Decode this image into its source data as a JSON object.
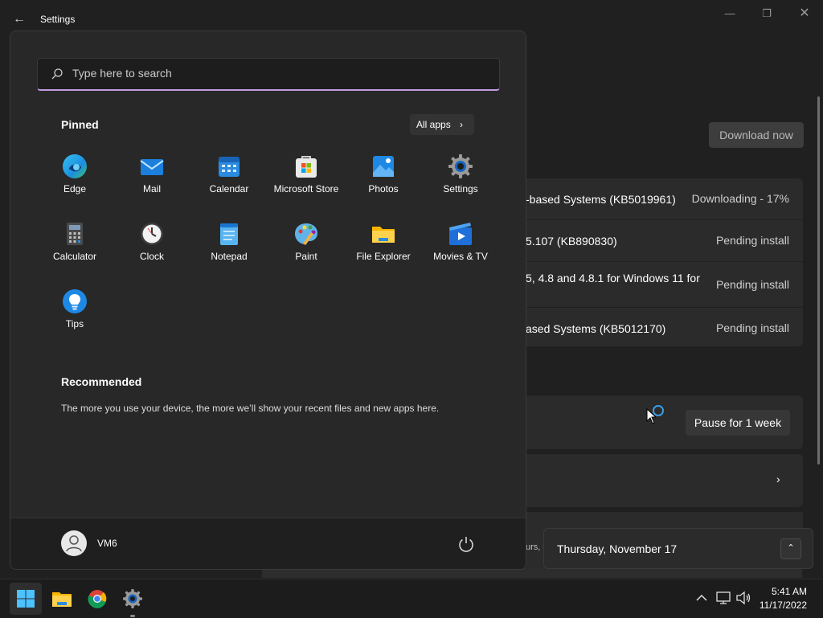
{
  "window": {
    "title": "Settings",
    "back_icon": "back-arrow-icon",
    "min_icon": "minimize-icon",
    "max_icon": "maximize-icon",
    "close_icon": "close-icon"
  },
  "updates": {
    "download_label": "Download now",
    "items": [
      {
        "name": "-based Systems (KB5019961)",
        "status": "Downloading - 17%"
      },
      {
        "name": "5.107 (KB890830)",
        "status": "Pending install"
      },
      {
        "name": "5, 4.8 and 4.8.1 for Windows 11 for",
        "status": "Pending install"
      },
      {
        "name": "ased Systems (KB5012170)",
        "status": "Pending install"
      }
    ],
    "pause_label": "Pause for 1 week",
    "partial_text": "urs, c"
  },
  "start": {
    "search_placeholder": "Type here to search",
    "pinned_title": "Pinned",
    "all_apps_label": "All apps",
    "apps": [
      {
        "label": "Edge",
        "icon": "edge-icon"
      },
      {
        "label": "Mail",
        "icon": "mail-icon"
      },
      {
        "label": "Calendar",
        "icon": "calendar-icon"
      },
      {
        "label": "Microsoft Store",
        "icon": "store-icon"
      },
      {
        "label": "Photos",
        "icon": "photos-icon"
      },
      {
        "label": "Settings",
        "icon": "settings-icon"
      },
      {
        "label": "Calculator",
        "icon": "calculator-icon"
      },
      {
        "label": "Clock",
        "icon": "clock-icon"
      },
      {
        "label": "Notepad",
        "icon": "notepad-icon"
      },
      {
        "label": "Paint",
        "icon": "paint-icon"
      },
      {
        "label": "File Explorer",
        "icon": "folder-icon"
      },
      {
        "label": "Movies & TV",
        "icon": "movies-icon"
      },
      {
        "label": "Tips",
        "icon": "tips-icon"
      }
    ],
    "recommended_title": "Recommended",
    "recommended_text": "The more you use your device, the more we’ll show your recent files and new apps here.",
    "user_name": "VM6"
  },
  "calendar": {
    "date_text": "Thursday, November 17"
  },
  "taskbar": {
    "apps": [
      "start-icon",
      "file-explorer-icon",
      "chrome-icon",
      "settings-icon"
    ],
    "time": "5:41 AM",
    "date": "11/17/2022"
  },
  "colors": {
    "accent_search_underline": "#c19adf",
    "background": "#202020",
    "start_bg": "#282828"
  }
}
